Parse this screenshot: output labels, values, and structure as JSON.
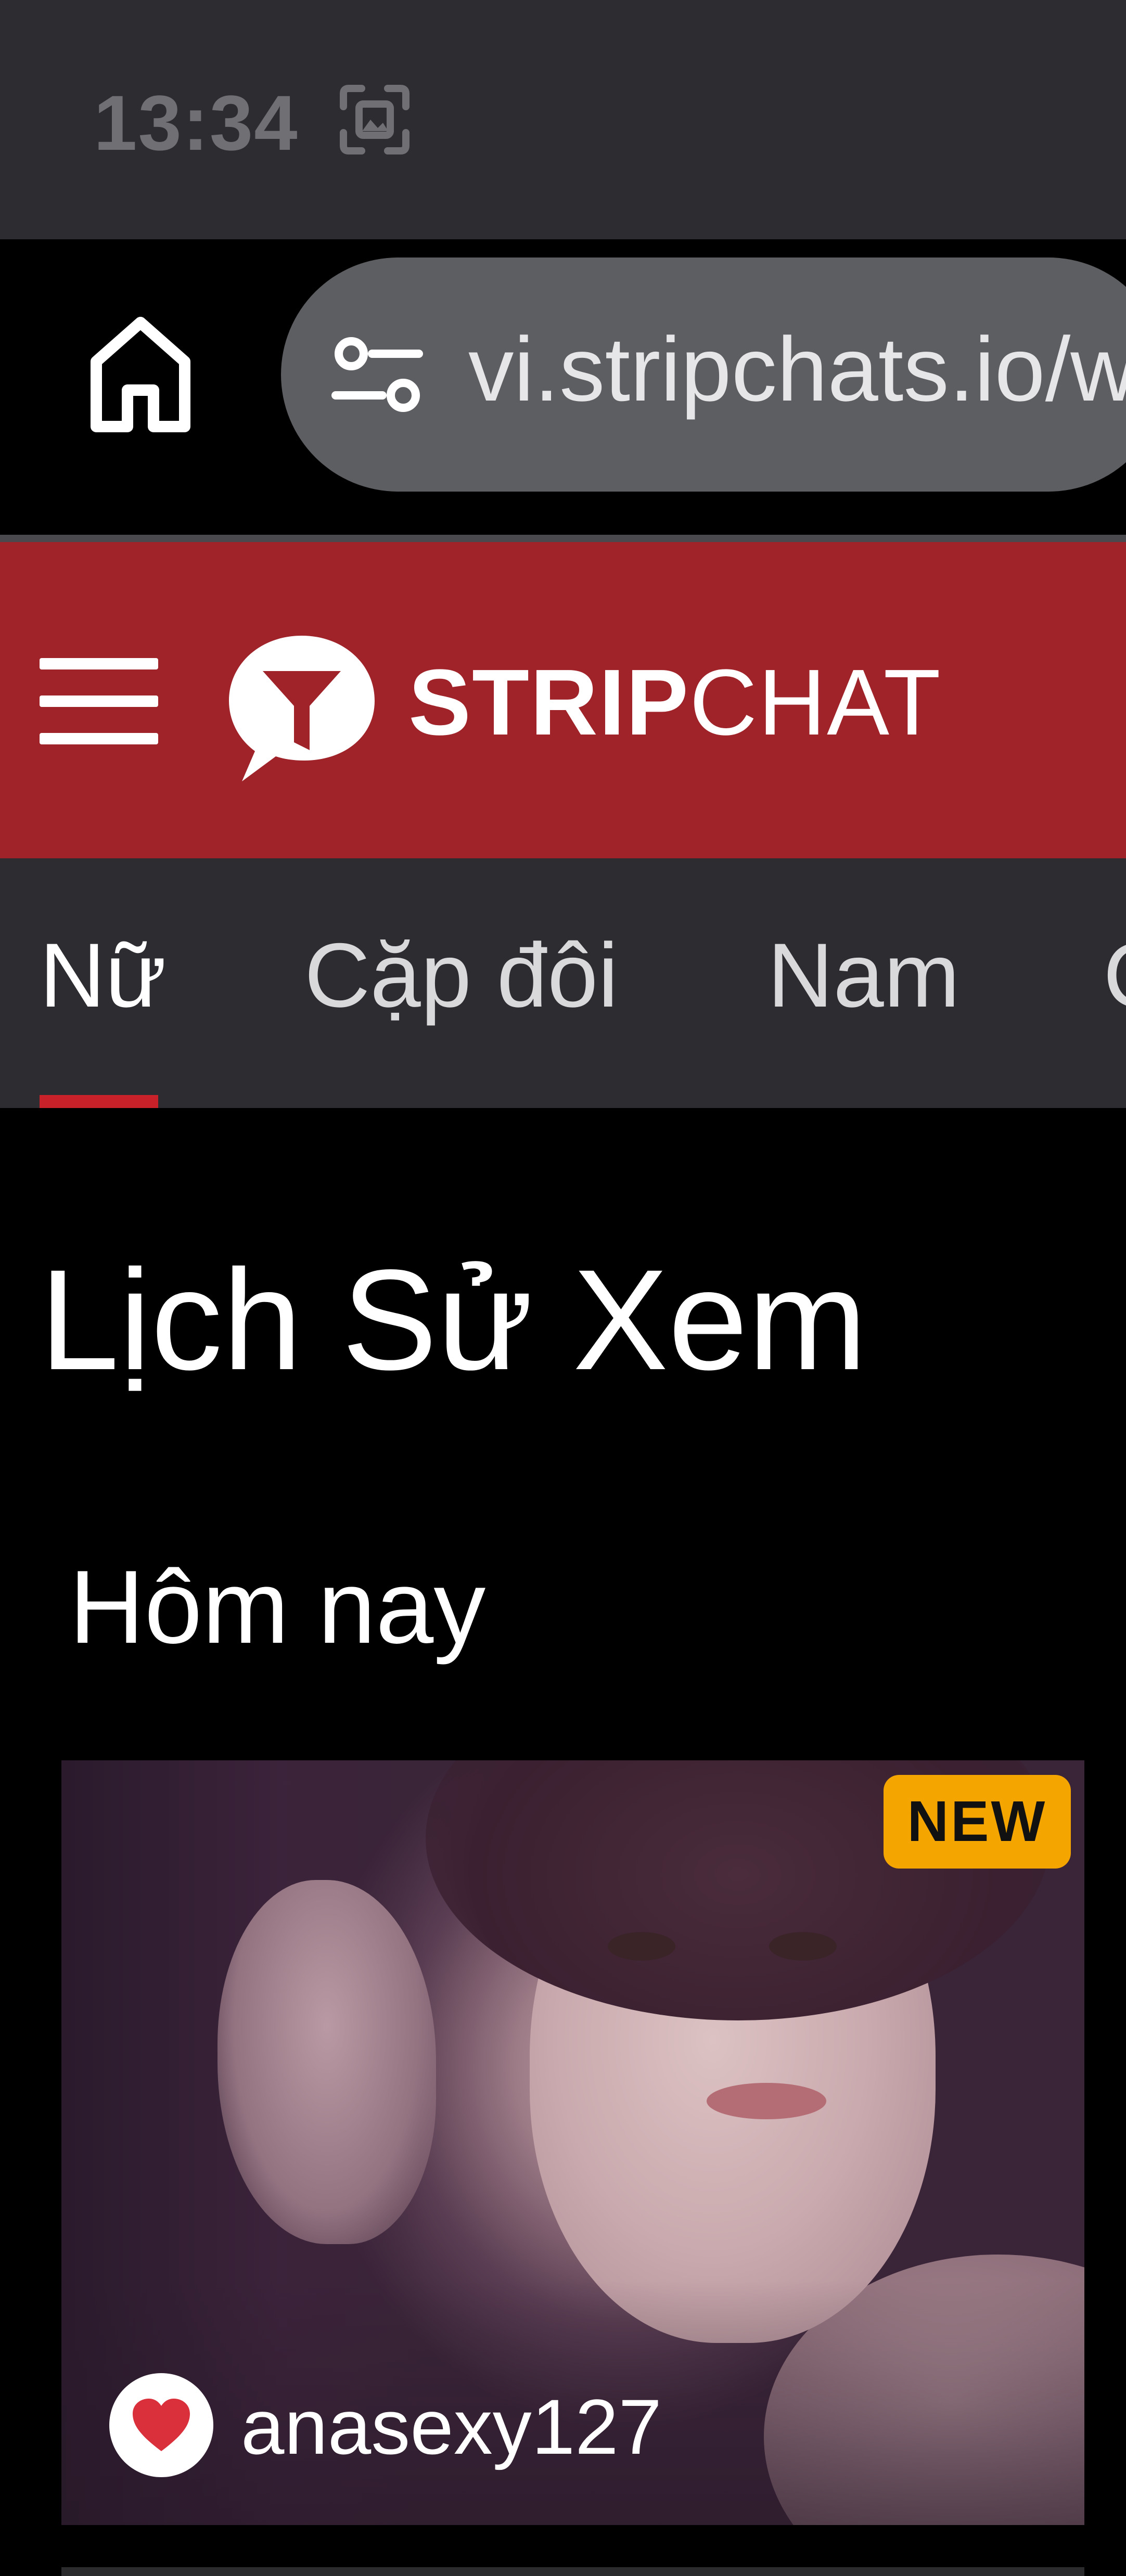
{
  "status_bar": {
    "time": "13:34",
    "icon": "screenshot-icon"
  },
  "browser": {
    "home_icon": "home-icon",
    "site_info_icon": "site-info-icon",
    "url": "vi.stripchats.io/w"
  },
  "header": {
    "menu_icon": "hamburger-menu-icon",
    "logo_icon": "stripchat-logo-icon",
    "logo_strong": "STRIP",
    "logo_light": "CHAT",
    "brand_color": "#a0232a"
  },
  "tabs": [
    {
      "label": "Nữ",
      "active": true
    },
    {
      "label": "Cặp đôi",
      "active": false
    },
    {
      "label": "Nam",
      "active": false
    },
    {
      "label": "C",
      "active": false
    }
  ],
  "main": {
    "page_title": "Lịch Sử Xem",
    "section_title": "Hôm nay",
    "cards": [
      {
        "badge": "NEW",
        "badge_color": "#f5a500",
        "favorite_icon": "heart-icon",
        "username": "anasexy127"
      }
    ]
  }
}
